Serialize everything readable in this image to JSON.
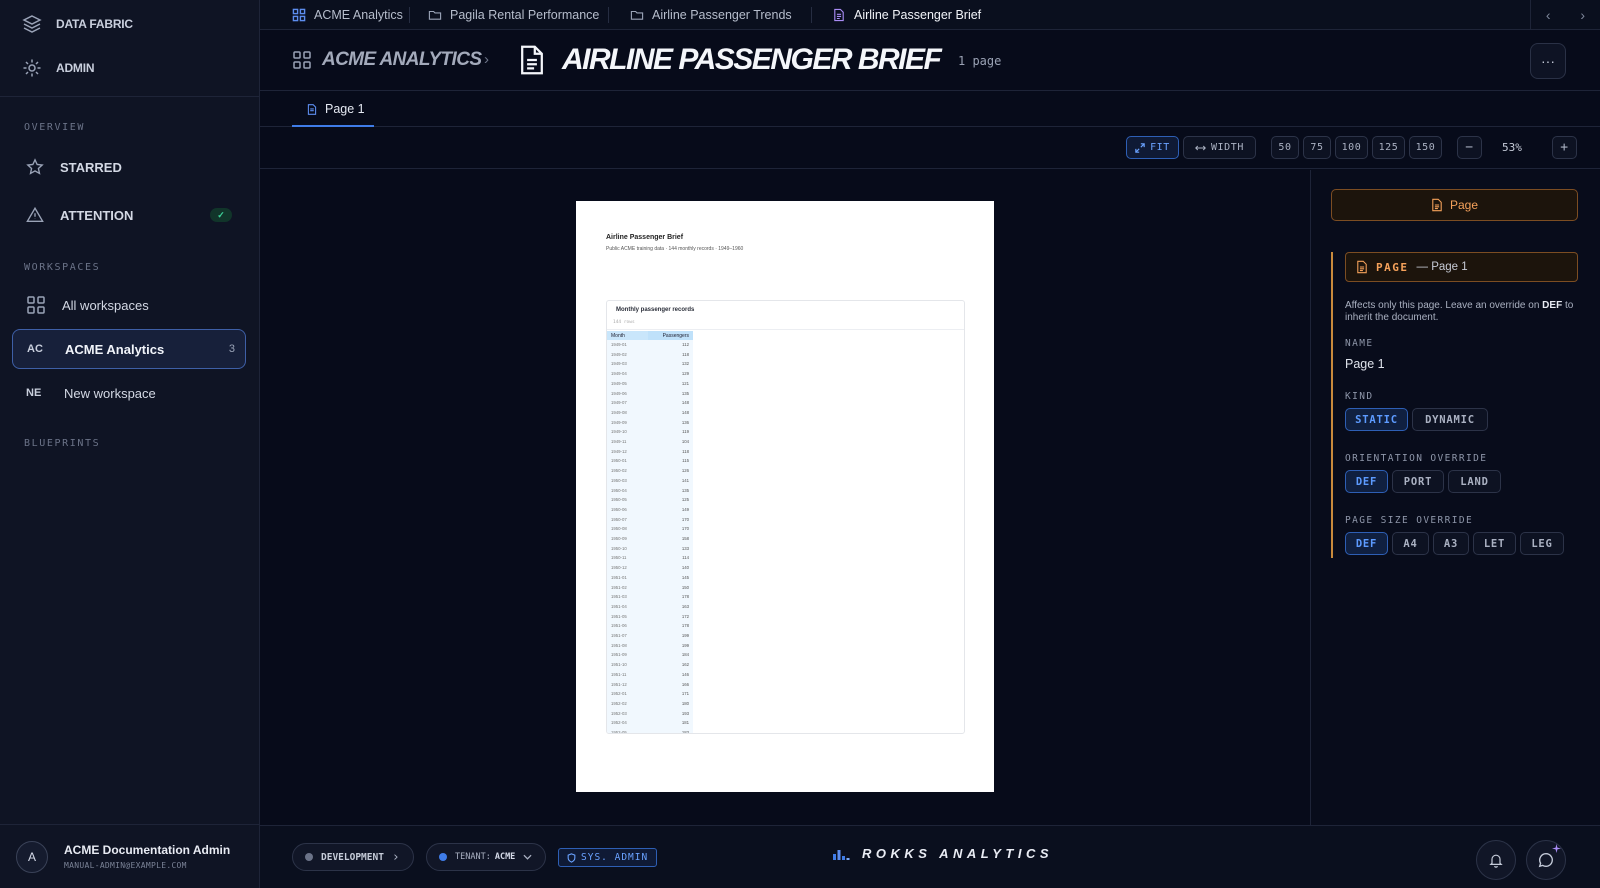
{
  "sidebar": {
    "top": [
      {
        "label": "DATA FABRIC",
        "icon": "layers-icon"
      },
      {
        "label": "ADMIN",
        "icon": "gear-icon"
      }
    ],
    "overview_label": "OVERVIEW",
    "overview_items": [
      {
        "label": "STARRED",
        "icon": "star-icon"
      },
      {
        "label": "ATTENTION",
        "icon": "warning-icon",
        "badge": "✓"
      }
    ],
    "workspaces_label": "WORKSPACES",
    "workspaces": [
      {
        "label": "All workspaces",
        "abbr": ""
      },
      {
        "label": "ACME Analytics",
        "abbr": "AC",
        "count": "3"
      },
      {
        "label": "New workspace",
        "abbr": "NE"
      }
    ],
    "blueprints_label": "BLUEPRINTS",
    "user": {
      "initial": "A",
      "name": "ACME Documentation Admin",
      "email": "MANUAL-ADMIN@EXAMPLE.COM"
    }
  },
  "tabs": [
    {
      "label": "ACME Analytics"
    },
    {
      "label": "Pagila Rental Performance"
    },
    {
      "label": "Airline Passenger Trends"
    },
    {
      "label": "Airline Passenger Brief"
    }
  ],
  "title_bar": {
    "breadcrumb": "ACME ANALYTICS",
    "separator": "›",
    "title": "AIRLINE PASSENGER BRIEF",
    "page_count": "1 page",
    "more": "···"
  },
  "page_tabs": [
    {
      "label": "Page 1"
    }
  ],
  "zoom": {
    "fit": "FIT",
    "width": "WIDTH",
    "presets": [
      "50",
      "75",
      "100",
      "125",
      "150"
    ],
    "minus": "−",
    "value": "53%",
    "plus": "+"
  },
  "document": {
    "title": "Airline Passenger Brief",
    "subtitle": "Public ACME training data · 144 monthly records · 1949–1960",
    "table_title": "Monthly passenger records",
    "row_count": "144 rows",
    "columns": [
      "Month",
      "Passengers"
    ],
    "rows": [
      [
        "1949-01",
        "112"
      ],
      [
        "1949-02",
        "118"
      ],
      [
        "1949-03",
        "132"
      ],
      [
        "1949-04",
        "129"
      ],
      [
        "1949-05",
        "121"
      ],
      [
        "1949-06",
        "135"
      ],
      [
        "1949-07",
        "148"
      ],
      [
        "1949-08",
        "148"
      ],
      [
        "1949-09",
        "136"
      ],
      [
        "1949-10",
        "119"
      ],
      [
        "1949-11",
        "104"
      ],
      [
        "1949-12",
        "118"
      ],
      [
        "1950-01",
        "115"
      ],
      [
        "1950-02",
        "126"
      ],
      [
        "1950-03",
        "141"
      ],
      [
        "1950-04",
        "135"
      ],
      [
        "1950-05",
        "125"
      ],
      [
        "1950-06",
        "149"
      ],
      [
        "1950-07",
        "170"
      ],
      [
        "1950-08",
        "170"
      ],
      [
        "1950-09",
        "158"
      ],
      [
        "1950-10",
        "133"
      ],
      [
        "1950-11",
        "114"
      ],
      [
        "1950-12",
        "140"
      ],
      [
        "1951-01",
        "145"
      ],
      [
        "1951-02",
        "150"
      ],
      [
        "1951-03",
        "178"
      ],
      [
        "1951-04",
        "163"
      ],
      [
        "1951-05",
        "172"
      ],
      [
        "1951-06",
        "178"
      ],
      [
        "1951-07",
        "199"
      ],
      [
        "1951-08",
        "199"
      ],
      [
        "1951-09",
        "184"
      ],
      [
        "1951-10",
        "162"
      ],
      [
        "1951-11",
        "146"
      ],
      [
        "1951-12",
        "166"
      ],
      [
        "1952-01",
        "171"
      ],
      [
        "1952-02",
        "180"
      ],
      [
        "1952-03",
        "193"
      ],
      [
        "1952-04",
        "181"
      ],
      [
        "1952-05",
        "183"
      ]
    ]
  },
  "panel": {
    "page_button": "Page",
    "section_label": "PAGE",
    "section_sub": "— Page 1",
    "desc_before": "Affects only this page. Leave an override on ",
    "desc_bold": "DEF",
    "desc_after": " to inherit the document.",
    "name_label": "NAME",
    "name_value": "Page 1",
    "kind_label": "KIND",
    "kind_options": [
      "STATIC",
      "DYNAMIC"
    ],
    "orientation_label": "ORIENTATION OVERRIDE",
    "orientation_options": [
      "DEF",
      "PORT",
      "LAND"
    ],
    "size_label": "PAGE SIZE OVERRIDE",
    "size_options": [
      "DEF",
      "A4",
      "A3",
      "LET",
      "LEG"
    ]
  },
  "footer": {
    "env": "DEVELOPMENT",
    "env_chevron": "›",
    "tenant_prefix": "TENANT:",
    "tenant": "ACME",
    "role": "SYS. ADMIN",
    "brand": "ROKKS ANALYTICS"
  },
  "colors": {
    "accent": "#3f7ce8",
    "page_orange": "#f5a15a",
    "success": "#3ed39a"
  }
}
